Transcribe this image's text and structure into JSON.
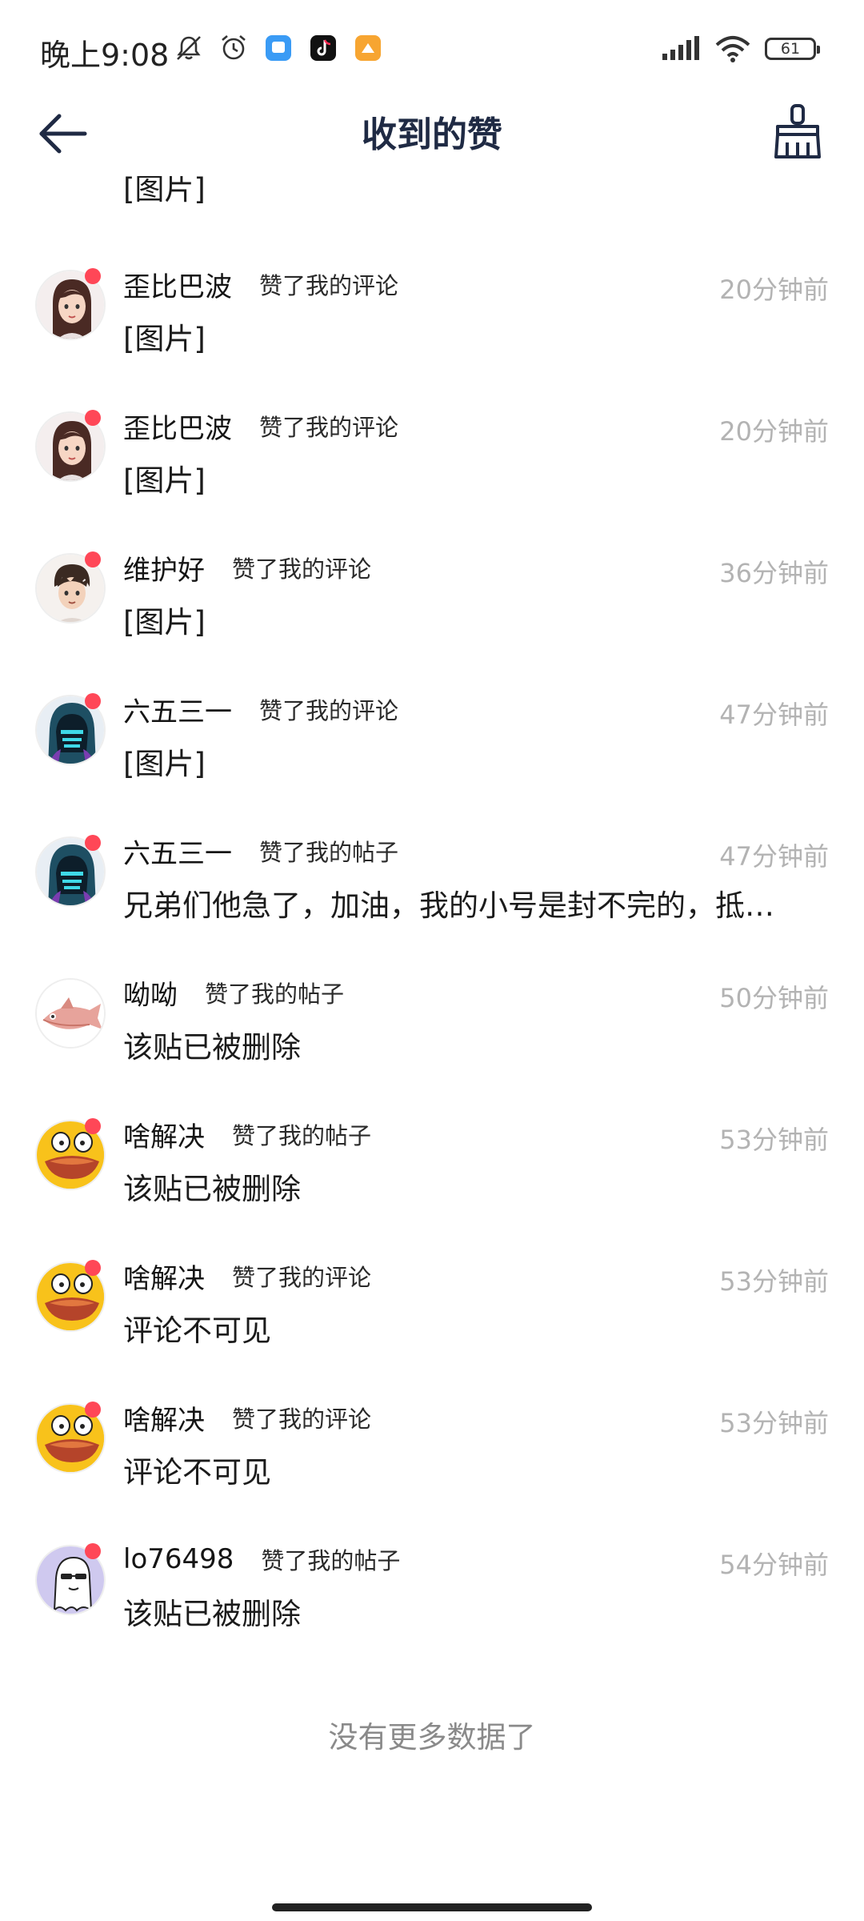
{
  "status_bar": {
    "time": "晚上9:08",
    "battery": "61",
    "icons": [
      "mute-icon",
      "alarm-icon",
      "app-blue-icon",
      "tiktok-icon",
      "app-orange-icon",
      "signal-icon",
      "wifi-icon",
      "battery-icon"
    ],
    "colors": {
      "blue_app": "#3a9bf5",
      "orange_app": "#f7a531"
    }
  },
  "header": {
    "title": "收到的赞",
    "back_icon": "arrow-left-icon",
    "clear_icon": "broom-icon"
  },
  "partial_item": {
    "content": "[图片]"
  },
  "items": [
    {
      "user": "歪比巴波",
      "action": "赞了我的评论",
      "time": "20分钟前",
      "content": "[图片]",
      "avatar": "girl",
      "unread": true
    },
    {
      "user": "歪比巴波",
      "action": "赞了我的评论",
      "time": "20分钟前",
      "content": "[图片]",
      "avatar": "girl",
      "unread": true
    },
    {
      "user": "维护好",
      "action": "赞了我的评论",
      "time": "36分钟前",
      "content": "[图片]",
      "avatar": "boy",
      "unread": true
    },
    {
      "user": "六五三一",
      "action": "赞了我的评论",
      "time": "47分钟前",
      "content": "[图片]",
      "avatar": "hooded",
      "unread": true
    },
    {
      "user": "六五三一",
      "action": "赞了我的帖子",
      "time": "47分钟前",
      "content": "兄弟们他急了，加油，我的小号是封不完的，抵…",
      "avatar": "hooded",
      "unread": true
    },
    {
      "user": "呦呦",
      "action": "赞了我的帖子",
      "time": "50分钟前",
      "content": "该贴已被删除",
      "avatar": "fish",
      "unread": false
    },
    {
      "user": "啥解决",
      "action": "赞了我的帖子",
      "time": "53分钟前",
      "content": "该贴已被删除",
      "avatar": "duck",
      "unread": true
    },
    {
      "user": "啥解决",
      "action": "赞了我的评论",
      "time": "53分钟前",
      "content": "评论不可见",
      "avatar": "duck",
      "unread": true
    },
    {
      "user": "啥解决",
      "action": "赞了我的评论",
      "time": "53分钟前",
      "content": "评论不可见",
      "avatar": "duck",
      "unread": true
    },
    {
      "user": "lo76498",
      "action": "赞了我的帖子",
      "time": "54分钟前",
      "content": "该贴已被删除",
      "avatar": "ghost",
      "unread": true
    }
  ],
  "footer": {
    "text": "没有更多数据了"
  },
  "colors": {
    "unread_dot": "#ff4757",
    "title": "#1f2a44",
    "time": "#b3b3b3"
  }
}
